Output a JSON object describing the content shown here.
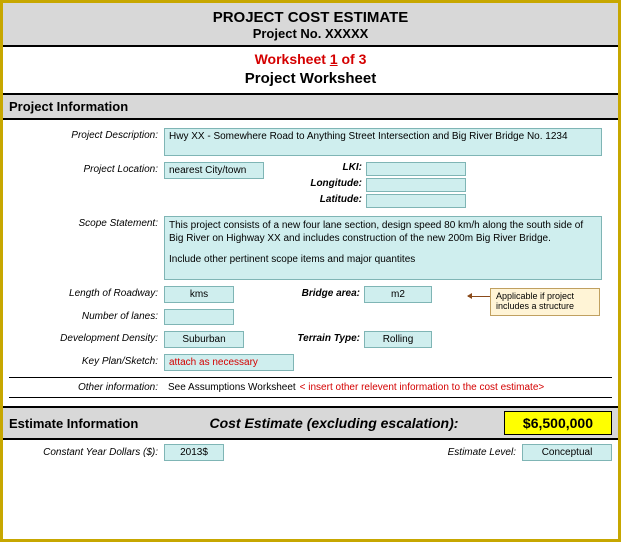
{
  "header": {
    "title1": "PROJECT COST ESTIMATE",
    "title2": "Project No. XXXXX"
  },
  "worksheet_line_prefix": "Worksheet ",
  "worksheet_num": "1",
  "worksheet_line_suffix": " of 3",
  "subtitle": "Project Worksheet",
  "section_project_info": "Project Information",
  "labels": {
    "project_description": "Project Description:",
    "project_location": "Project Location:",
    "lki": "LKI:",
    "longitude": "Longitude:",
    "latitude": "Latitude:",
    "scope_statement": "Scope Statement:",
    "length_roadway": "Length of Roadway:",
    "bridge_area": "Bridge area:",
    "number_lanes": "Number of lanes:",
    "dev_density": "Development Density:",
    "terrain_type": "Terrain Type:",
    "key_plan": "Key Plan/Sketch:",
    "other_info": "Other information:",
    "constant_year": "Constant Year Dollars ($):",
    "estimate_level": "Estimate Level:"
  },
  "values": {
    "project_description": "Hwy XX - Somewhere Road to Anything Street Intersection and Big River Bridge No. 1234",
    "project_location": "nearest City/town",
    "lki": "",
    "longitude": "",
    "latitude": "",
    "scope_line1": "This project consists of a new four lane section, design speed 80 km/h along the south side of Big River on Highway XX and includes construction of the new 200m Big River Bridge.",
    "scope_line2": "Include other pertinent scope items and major quantites",
    "length_roadway": "kms",
    "bridge_area": "m2",
    "number_lanes": "",
    "dev_density": "Suburban",
    "terrain_type": "Rolling",
    "key_plan": "attach as necessary",
    "other_info_prefix": "See Assumptions Worksheet",
    "other_info_red": "< insert other relevent information to the cost estimate>",
    "constant_year": "2013$",
    "estimate_level": "Conceptual"
  },
  "callout": "Applicable if project includes a structure",
  "estimate": {
    "section_label": "Estimate Information",
    "center_text": "Cost Estimate (excluding escalation):",
    "amount": "$6,500,000"
  }
}
